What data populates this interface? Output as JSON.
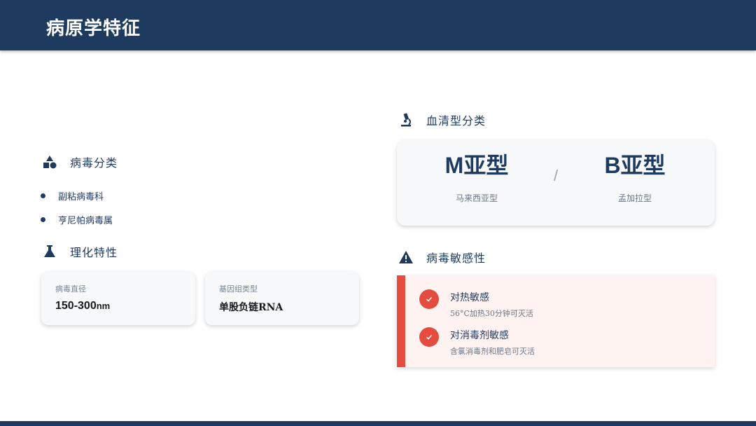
{
  "header": {
    "title": "病原学特征"
  },
  "classification": {
    "heading": "病毒分类",
    "icon": "shapes-icon",
    "items": [
      "副粘病毒科",
      "亨尼帕病毒属"
    ]
  },
  "properties": {
    "heading": "理化特性",
    "icon": "flask-icon",
    "cards": [
      {
        "label": "病毒直径",
        "value": "150-300",
        "unit": "nm"
      },
      {
        "label": "基因组类型",
        "value": "单股负链RNA",
        "unit": ""
      }
    ]
  },
  "serotypes": {
    "heading": "血清型分类",
    "icon": "microscope-icon",
    "separator": "/",
    "items": [
      {
        "name": "M亚型",
        "desc": "马来西亚型"
      },
      {
        "name": "B亚型",
        "desc": "孟加拉型"
      }
    ]
  },
  "sensitivity": {
    "heading": "病毒敏感性",
    "icon": "warning-icon",
    "items": [
      {
        "title": "对热敏感",
        "desc": "56°C加热30分钟可灭活"
      },
      {
        "title": "对消毒剂敏感",
        "desc": "含氯消毒剂和肥皂可灭活"
      }
    ]
  },
  "colors": {
    "primary": "#1f3a5f",
    "accent": "#e54b3e",
    "card_bg": "#f6f8fa",
    "alert_bg": "#fff3f2"
  }
}
